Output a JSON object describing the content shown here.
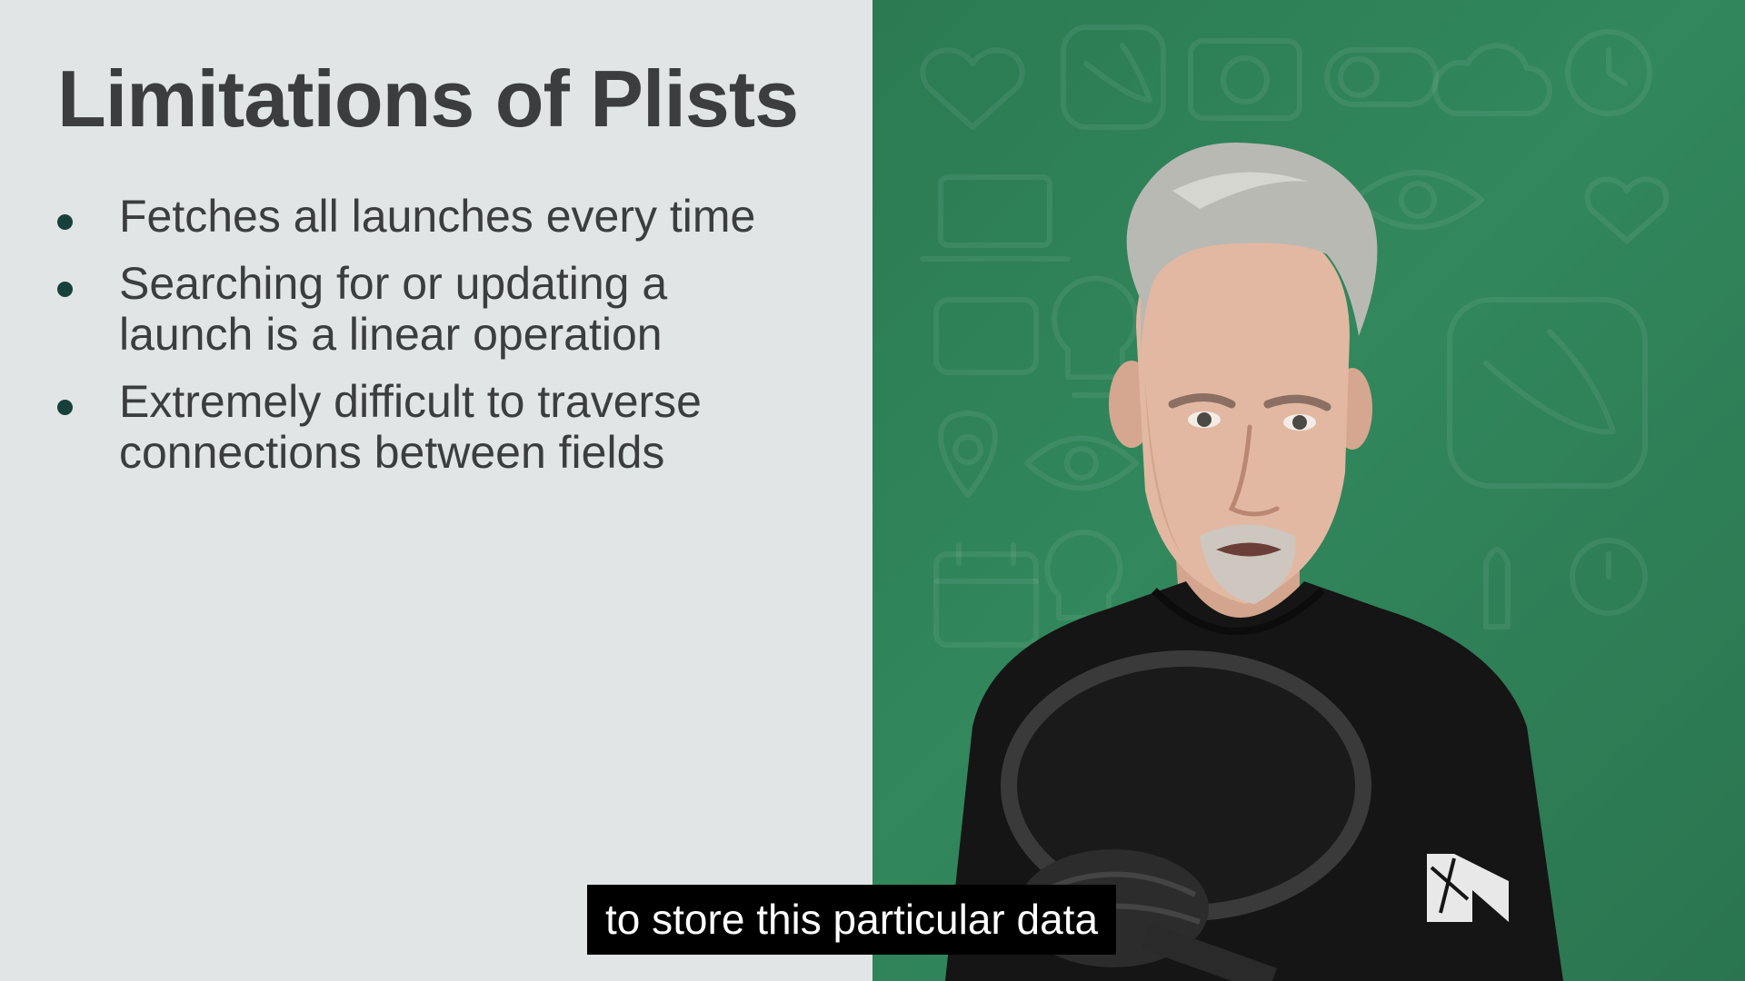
{
  "slide": {
    "title": "Limitations of Plists",
    "bullets": [
      {
        "lines": [
          "Fetches all launches every time"
        ]
      },
      {
        "lines": [
          "Searching for or updating a",
          "launch is a linear operation"
        ]
      },
      {
        "lines": [
          "Extremely difficult to traverse",
          "connections between fields"
        ]
      }
    ]
  },
  "video": {
    "background_color": "#2f8057",
    "background_icons": [
      "heart-icon",
      "swift-icon",
      "camera-icon",
      "toggle-icon",
      "cloud-icon",
      "person-icon",
      "laptop-icon",
      "lightbulb-icon",
      "location-pin-icon",
      "eye-icon",
      "calendar-icon",
      "rocket-icon",
      "clock-icon"
    ]
  },
  "caption": {
    "text": "to store this particular data"
  },
  "colors": {
    "slide_background": "#e1e5e6",
    "text": "#3b3d3f",
    "bullet": "#18403a",
    "caption_background": "#000000",
    "caption_text": "#ffffff"
  }
}
